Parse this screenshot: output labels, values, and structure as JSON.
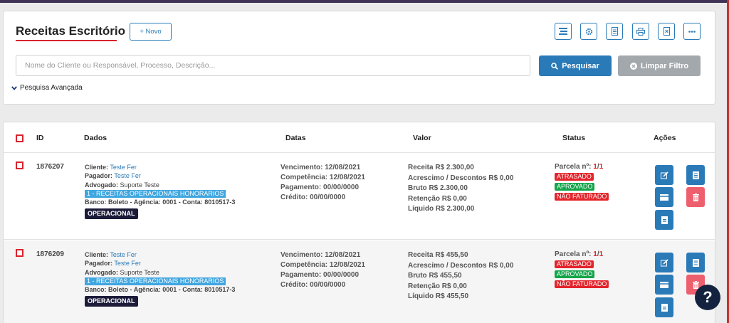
{
  "header": {
    "title": "Receitas Escritório",
    "novo_label": "+ Novo",
    "tools": [
      "list-icon",
      "gear-icon",
      "document-icon",
      "print-icon",
      "export-icon",
      "more-icon"
    ]
  },
  "search": {
    "placeholder": "Nome do Cliente ou Responsável, Processo, Descrição...",
    "value": "",
    "search_label": "Pesquisar",
    "clear_label": "Limpar Filtro",
    "advanced_label": "Pesquisa Avançada"
  },
  "table": {
    "columns": {
      "id": "ID",
      "dados": "Dados",
      "datas": "Datas",
      "valor": "Valor",
      "status": "Status",
      "acoes": "Ações"
    },
    "rows": [
      {
        "id": "1876207",
        "cliente_label": "Cliente:",
        "cliente": "Teste Fer",
        "pagador_label": "Pagador:",
        "pagador": "Teste Fer",
        "advogado_label": "Advogado:",
        "advogado": "Suporte Teste",
        "categoria": "1 - RECEITAS OPERACIONAIS HONORARIOS",
        "banco_label": "Banco:",
        "banco": "Boleto",
        "agencia_label": "- Agência:",
        "agencia": "0001",
        "conta_label": "- Conta:",
        "conta": "8010517-3",
        "tag": "OPERACIONAL",
        "vencimento": "Vencimento: 12/08/2021",
        "competencia": "Competência: 12/08/2021",
        "pagamento": "Pagamento: 00/00/0000",
        "credito": "Crédito: 00/00/0000",
        "receita": "Receita R$ 2.300,00",
        "acrescimo": "Acrescimo / Descontos R$ 0,00",
        "bruto": "Bruto R$ 2.300,00",
        "retencao": "Retenção R$ 0,00",
        "liquido": "Líquido R$ 2.300,00",
        "parcela_label": "Parcela nº:",
        "parcela_atual": "1",
        "parcela_sep": "/",
        "parcela_total": "1",
        "status1": "ATRASADO",
        "status2": "APROVADO",
        "status3": "NÃO FATURADO"
      },
      {
        "id": "1876209",
        "cliente_label": "Cliente:",
        "cliente": "Teste Fer",
        "pagador_label": "Pagador:",
        "pagador": "Teste Fer",
        "advogado_label": "Advogado:",
        "advogado": "Suporte Teste",
        "categoria": "1 - RECEITAS OPERACIONAIS HONORARIOS",
        "banco_label": "Banco:",
        "banco": "Boleto",
        "agencia_label": "- Agência:",
        "agencia": "0001",
        "conta_label": "- Conta:",
        "conta": "8010517-3",
        "tag": "OPERACIONAL",
        "vencimento": "Vencimento: 12/08/2021",
        "competencia": "Competência: 12/08/2021",
        "pagamento": "Pagamento: 00/00/0000",
        "credito": "Crédito: 00/00/0000",
        "receita": "Receita R$ 455,50",
        "acrescimo": "Acrescimo / Descontos R$ 0,00",
        "bruto": "Bruto R$ 455,50",
        "retencao": "Retenção R$ 0,00",
        "liquido": "Líquido R$ 455,50",
        "parcela_label": "Parcela nº:",
        "parcela_atual": "1",
        "parcela_sep": "/",
        "parcela_total": "1",
        "status1": "ATRASADO",
        "status2": "APROVADO",
        "status3": "NÃO FATURADO"
      }
    ]
  },
  "help_label": "?",
  "colors": {
    "primary": "#2a7ab8",
    "danger": "#d9232c",
    "success": "#13a54a",
    "muted": "#a3a8ad"
  }
}
